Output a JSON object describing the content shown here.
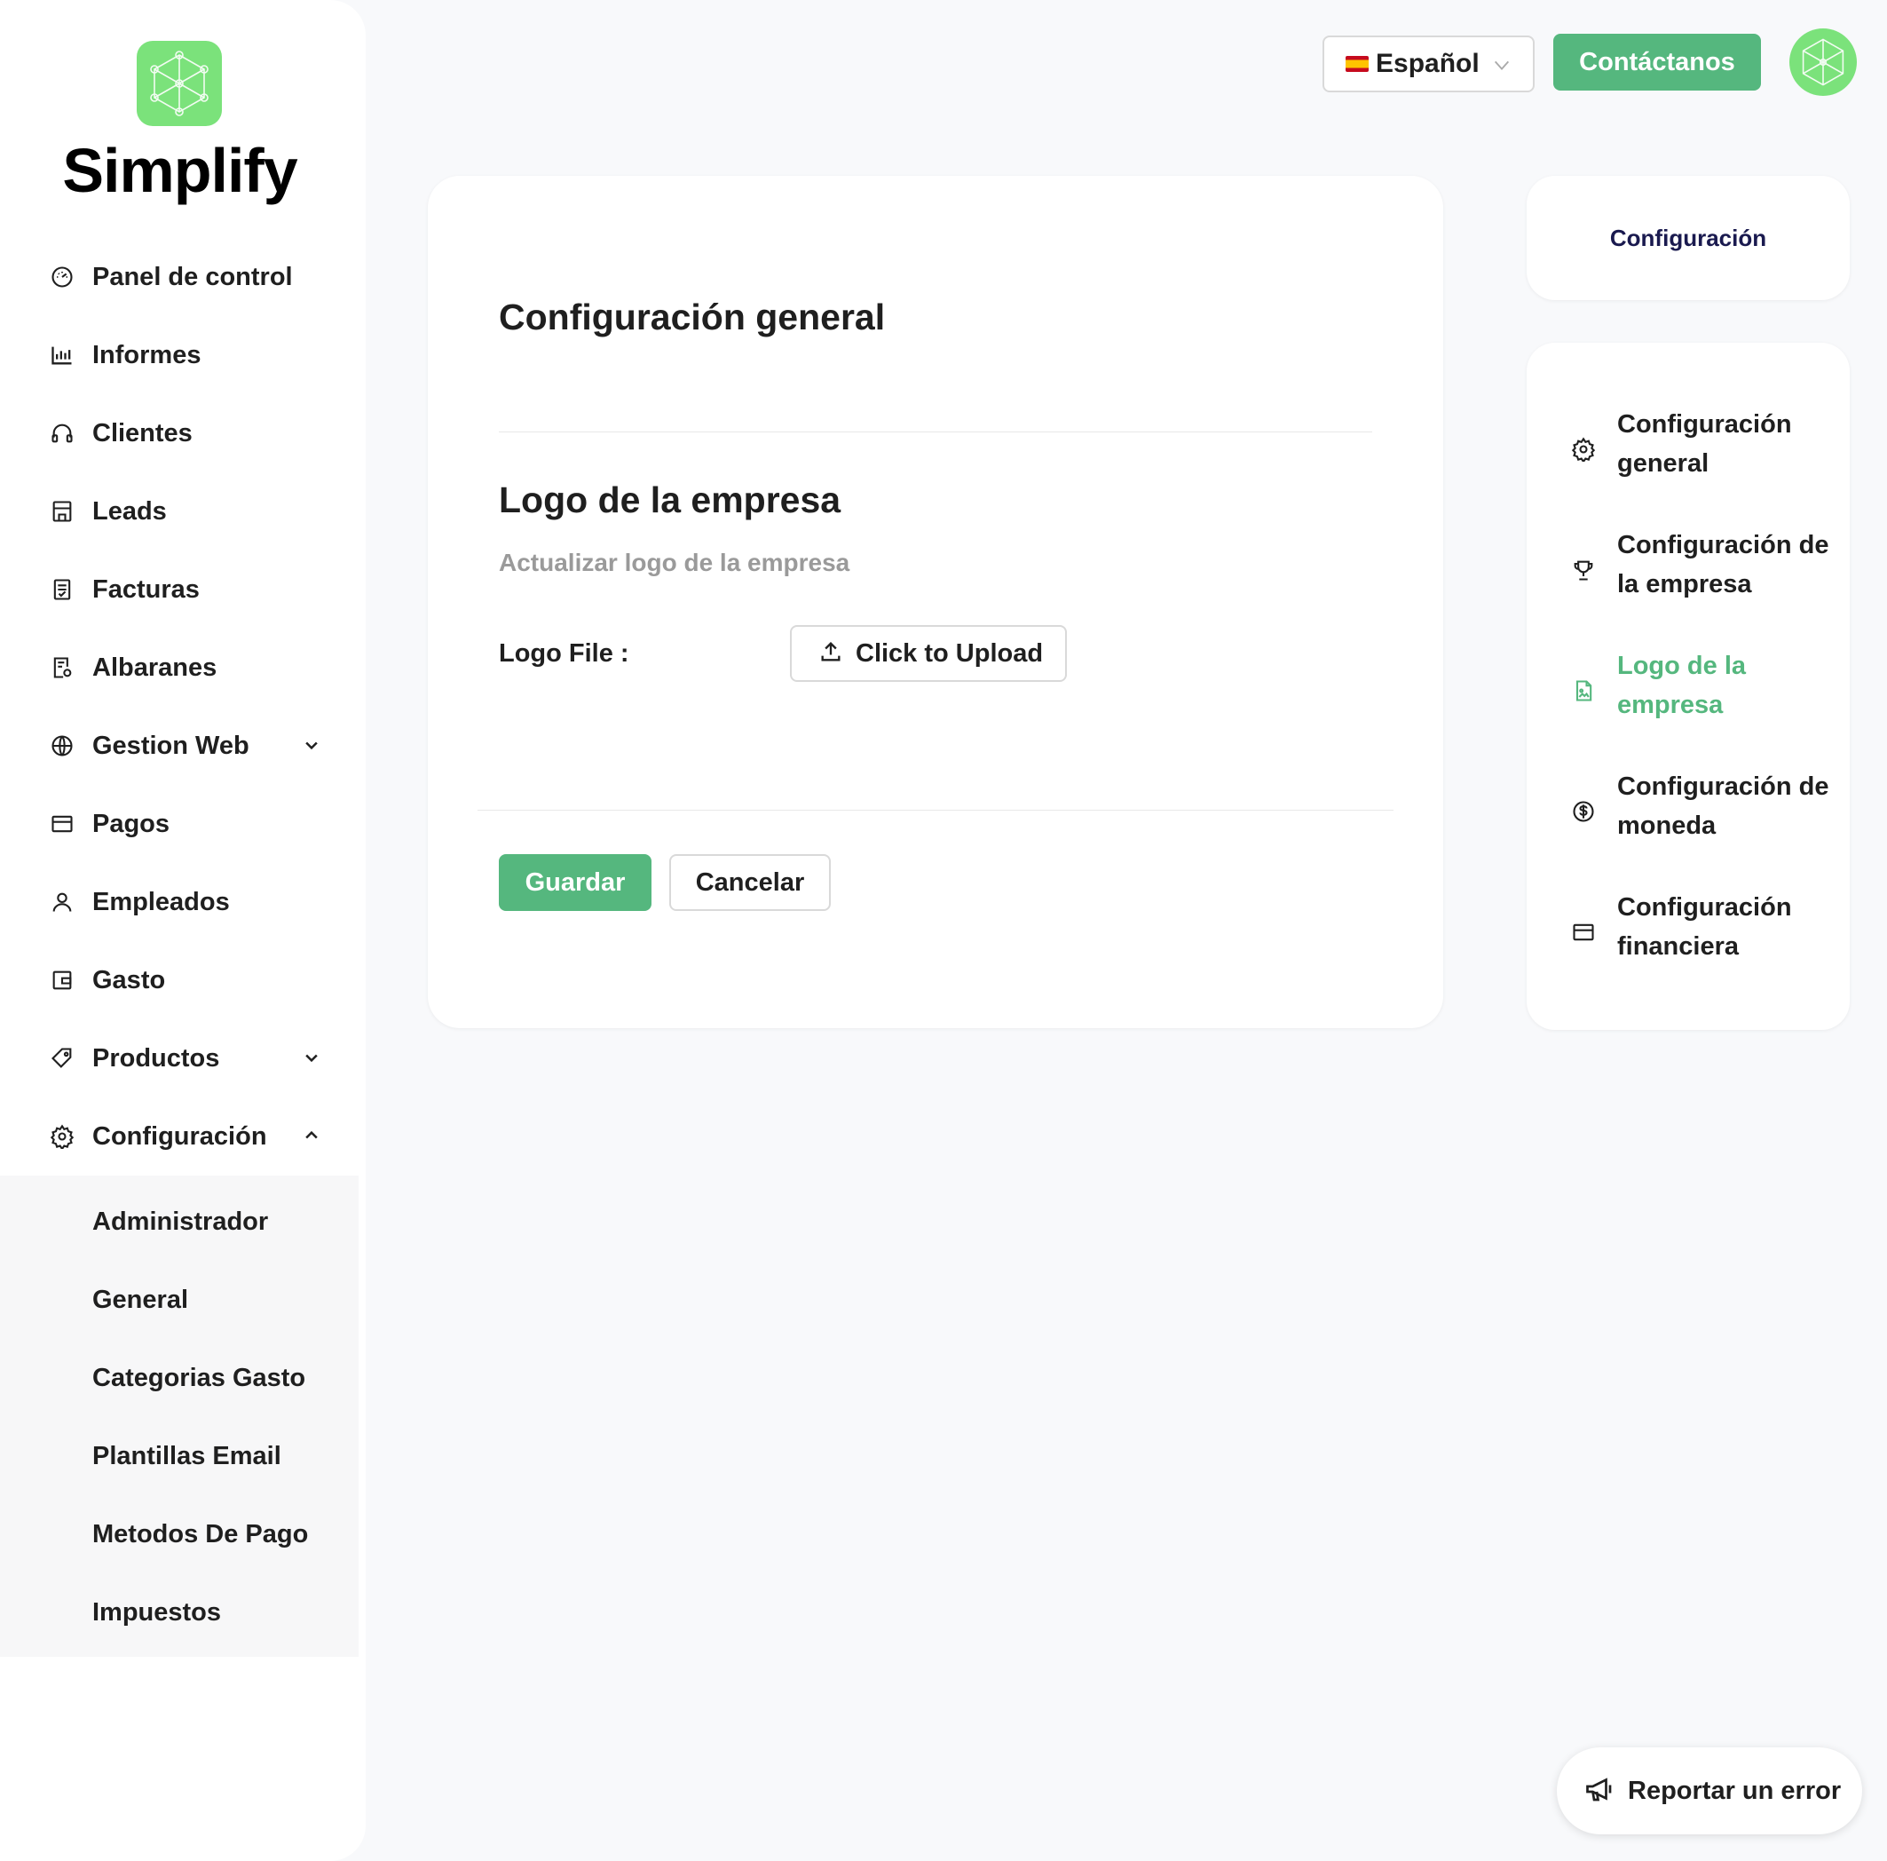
{
  "brand": {
    "name": "Simplify"
  },
  "sidebar": {
    "items": [
      {
        "label": "Panel de control",
        "icon": "dashboard-icon"
      },
      {
        "label": "Informes",
        "icon": "bar-chart-icon"
      },
      {
        "label": "Clientes",
        "icon": "headphones-icon"
      },
      {
        "label": "Leads",
        "icon": "store-icon"
      },
      {
        "label": "Facturas",
        "icon": "invoice-icon"
      },
      {
        "label": "Albaranes",
        "icon": "delivery-note-icon"
      },
      {
        "label": "Gestion Web",
        "icon": "globe-icon",
        "expandable": true,
        "expanded": false
      },
      {
        "label": "Pagos",
        "icon": "credit-card-icon"
      },
      {
        "label": "Empleados",
        "icon": "user-icon"
      },
      {
        "label": "Gasto",
        "icon": "wallet-icon"
      },
      {
        "label": "Productos",
        "icon": "tag-icon",
        "expandable": true,
        "expanded": false
      },
      {
        "label": "Configuración",
        "icon": "gear-icon",
        "expandable": true,
        "expanded": true
      }
    ],
    "submenu": [
      {
        "label": "Administrador"
      },
      {
        "label": "General"
      },
      {
        "label": "Categorias Gasto"
      },
      {
        "label": "Plantillas Email"
      },
      {
        "label": "Metodos De Pago"
      },
      {
        "label": "Impuestos"
      }
    ]
  },
  "header": {
    "language": "Español",
    "contact_label": "Contáctanos"
  },
  "main": {
    "title": "Configuración general",
    "section_title": "Logo de la empresa",
    "section_subtitle": "Actualizar logo de la empresa",
    "logo_field_label": "Logo File :",
    "upload_label": "Click to Upload",
    "save_label": "Guardar",
    "cancel_label": "Cancelar"
  },
  "right_panel": {
    "title": "Configuración",
    "items": [
      {
        "label": "Configuración general",
        "icon": "gear-icon",
        "active": false
      },
      {
        "label": "Configuración de la empresa",
        "icon": "trophy-icon",
        "active": false
      },
      {
        "label": "Logo de la empresa",
        "icon": "image-file-icon",
        "active": true
      },
      {
        "label": "Configuración de moneda",
        "icon": "dollar-circle-icon",
        "active": false
      },
      {
        "label": "Configuración financiera",
        "icon": "credit-card-icon",
        "active": false
      }
    ]
  },
  "report_error": {
    "label": "Reportar un error"
  },
  "colors": {
    "accent": "#55b77e",
    "logo_bg": "#7be27b",
    "panel_title": "#1a1a4f"
  }
}
